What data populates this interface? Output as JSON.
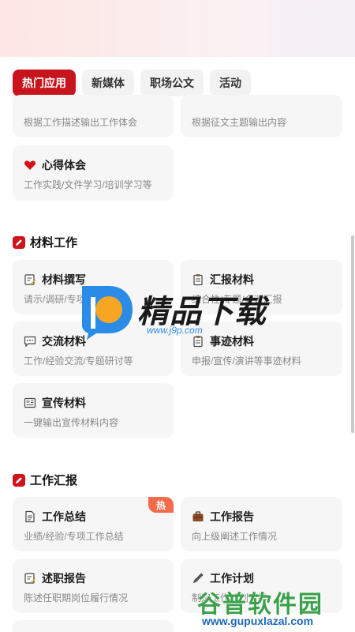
{
  "tabs": [
    {
      "label": "热门应用",
      "active": true
    },
    {
      "label": "新媒体",
      "active": false
    },
    {
      "label": "职场公文",
      "active": false
    },
    {
      "label": "活动",
      "active": false
    }
  ],
  "hot_apps": {
    "partial_cards": [
      {
        "desc": "根据工作描述输出工作体会"
      },
      {
        "desc": "根据征文主题输出内容"
      }
    ],
    "cards": [
      {
        "title": "心得体会",
        "desc": "工作实践/文件学习/培训学习等",
        "icon": "heart-icon"
      }
    ]
  },
  "sections": [
    {
      "title": "材料工作",
      "icon": "pencil-icon",
      "cards": [
        {
          "title": "材料撰写",
          "desc": "请示/调研/专项/发言等",
          "icon": "note-edit-icon"
        },
        {
          "title": "汇报材料",
          "desc": "综合性/专题/会议汇报",
          "icon": "clipboard-icon"
        },
        {
          "title": "交流材料",
          "desc": "工作/经验交流/专题研讨等",
          "icon": "chat-icon"
        },
        {
          "title": "事迹材料",
          "desc": "申报/宣传/演讲等事迹材料",
          "icon": "clipboard-icon"
        },
        {
          "title": "宣传材料",
          "desc": "一键输出宣传材料内容",
          "icon": "newspaper-icon"
        }
      ]
    },
    {
      "title": "工作汇报",
      "icon": "pencil-icon",
      "cards": [
        {
          "title": "工作总结",
          "desc": "业绩/经验/专项工作总结",
          "icon": "document-icon",
          "badge": "热"
        },
        {
          "title": "工作报告",
          "desc": "向上级阐述工作情况",
          "icon": "briefcase-icon"
        },
        {
          "title": "述职报告",
          "desc": "陈述任职期岗位履行情况",
          "icon": "note-edit-icon"
        },
        {
          "title": "工作计划",
          "desc": "制定工作计划安排",
          "icon": "pen-icon"
        }
      ]
    }
  ],
  "watermarks": {
    "top_brand": "精品下载",
    "top_url": "www.j9p.com",
    "bottom_brand": "谷普软件园",
    "bottom_url": "www.gupuxlazal.com"
  },
  "colors": {
    "accent": "#c8151d",
    "card_bg": "#f6f6f6",
    "hot_badge": "#f26b4b"
  }
}
